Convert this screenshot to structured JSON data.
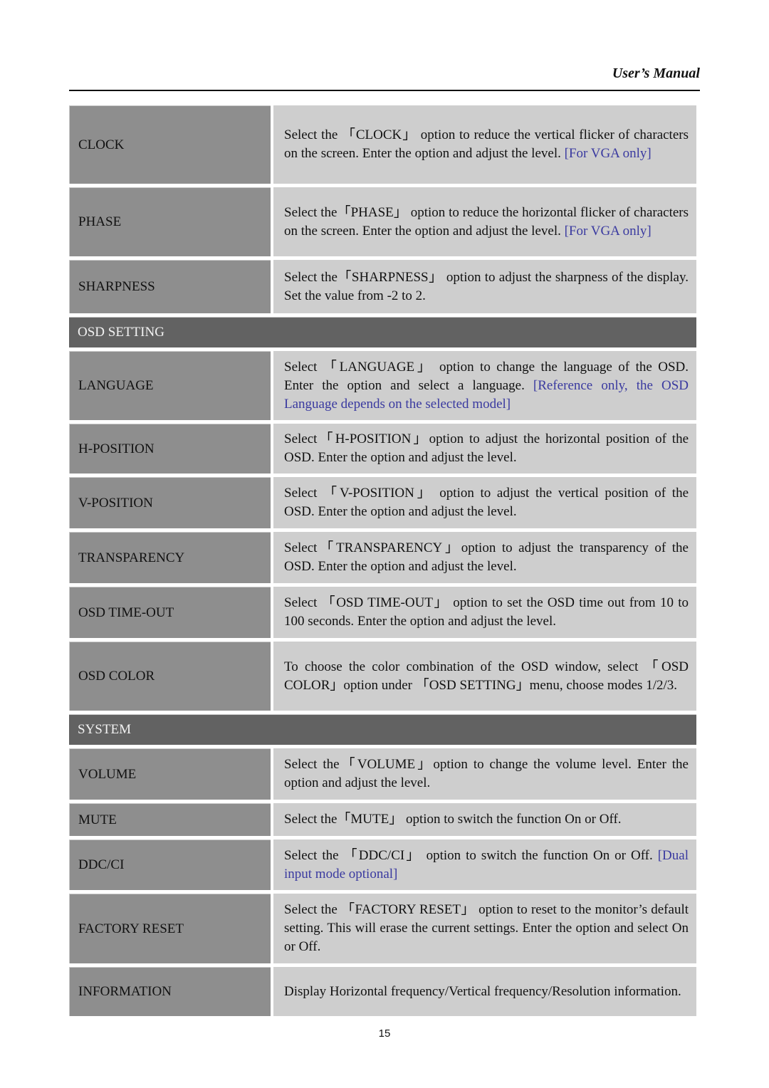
{
  "header": {
    "title": "User’s Manual"
  },
  "rows": [
    {
      "type": "item",
      "label": "CLOCK",
      "text": "Select the 「CLOCK」 option to reduce the vertical flicker of characters on the screen. Enter the option and adjust the level.",
      "note": "[For VGA only]"
    },
    {
      "type": "item",
      "label": "PHASE",
      "text": "Select the「PHASE」 option to reduce the horizontal flicker of characters on the screen. Enter the option and adjust the level.",
      "note": "[For VGA only]"
    },
    {
      "type": "item",
      "label": "SHARPNESS",
      "text": "Select the「SHARPNESS」 option to adjust the sharpness of the display. Set the value from -2 to 2.",
      "note": ""
    },
    {
      "type": "section",
      "label": "OSD SETTING"
    },
    {
      "type": "item",
      "label": "LANGUAGE",
      "text": "Select 「LANGUAGE」 option to change the language of the OSD. Enter the option and select a language.",
      "note": "[Reference only, the OSD Language depends on the selected model]"
    },
    {
      "type": "item",
      "label": "H-POSITION",
      "text": "Select「H-POSITION」option to adjust the horizontal position of the OSD. Enter the option and adjust the level.",
      "note": ""
    },
    {
      "type": "item",
      "label": "V-POSITION",
      "text": "Select 「V-POSITION」 option to adjust the vertical position of the OSD. Enter the option and adjust the level.",
      "note": ""
    },
    {
      "type": "item",
      "label": "TRANSPARENCY",
      "text": "Select「TRANSPARENCY」option to adjust the transparency of the OSD. Enter the option and adjust the level.",
      "note": ""
    },
    {
      "type": "item",
      "label": "OSD TIME-OUT",
      "text": "Select 「OSD TIME-OUT」 option to set the OSD time out from 10 to 100 seconds. Enter the option and adjust the level.",
      "note": ""
    },
    {
      "type": "item",
      "label": "OSD COLOR",
      "text": "To choose the color combination of the OSD window, select 「OSD COLOR」option under 「OSD SETTING」menu, choose modes 1/2/3.",
      "note": ""
    },
    {
      "type": "section",
      "label": "SYSTEM"
    },
    {
      "type": "item",
      "label": "VOLUME",
      "text": "Select the「VOLUME」option to change the volume level. Enter the option and adjust the level.",
      "note": ""
    },
    {
      "type": "item",
      "label": "MUTE",
      "text": "Select the「MUTE」 option to switch the function On or Off.",
      "note": ""
    },
    {
      "type": "item",
      "label": "DDC/CI",
      "text": "Select the 「DDC/CI」 option to switch the function On or Off.",
      "note": "[Dual input mode optional]"
    },
    {
      "type": "item",
      "label": "FACTORY RESET",
      "text": "Select the 「FACTORY RESET」 option to reset to the monitor’s default setting. This will erase the current settings. Enter the option and select On or Off.",
      "note": ""
    },
    {
      "type": "item",
      "label": "INFORMATION",
      "text": "Display Horizontal frequency/Vertical frequency/Resolution information.",
      "note": ""
    }
  ],
  "footer": {
    "page_number": "15"
  },
  "colors": {
    "label_bg": "#8e8e8e",
    "desc_bg": "#cecece",
    "section_bg": "#626262",
    "note": "#3a3aa0"
  }
}
